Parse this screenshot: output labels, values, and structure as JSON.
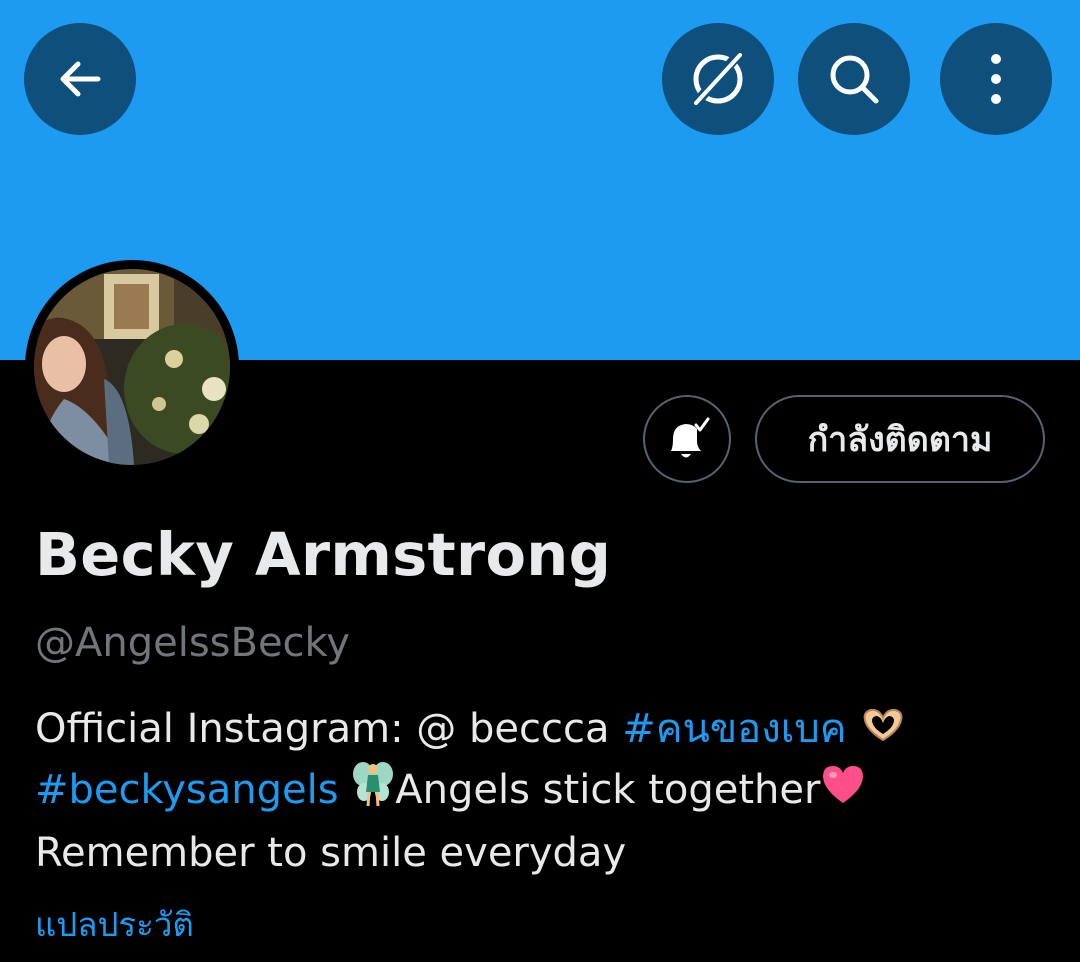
{
  "header": {
    "back_icon": "arrow-left-icon",
    "grok_icon": "grok-icon",
    "search_icon": "search-icon",
    "more_icon": "more-vertical-icon",
    "banner_color": "#1d9bf0",
    "button_bg": "#0f4f7c"
  },
  "profile": {
    "notifications_icon": "bell-check-icon",
    "follow_label": "กำลังติดตาม",
    "name": "Becky Armstrong",
    "handle": "@AngelssBecky",
    "bio": {
      "line1_text": "Official Instagram: @ beccca ",
      "line1_hashtag": "#คนของเบค",
      "line1_emoji": "heart-hands-emoji",
      "line2_hashtag": "#beckysangels",
      "line2_emoji": "fairy-emoji",
      "line2_text": "Angels stick together",
      "line2_emoji2": "pink-heart-emoji",
      "line3_text": "Remember to smile everyday"
    },
    "translate_label": "แปลประวัติ"
  },
  "colors": {
    "link": "#1d9bf0",
    "text": "#e7e9ea",
    "muted": "#71767b",
    "border": "#536471"
  }
}
